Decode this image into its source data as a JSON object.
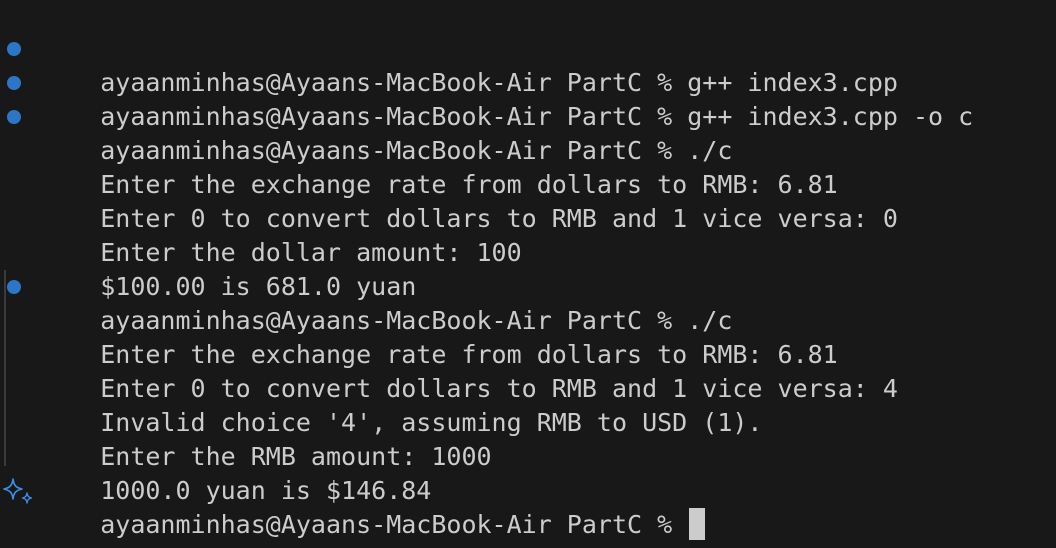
{
  "terminal": {
    "colors": {
      "background": "#181818",
      "text": "#cccccc",
      "command_dot": "#2c76c8",
      "sparkle": "#3b8eea"
    },
    "lines": [
      {
        "marker": "dot",
        "text": "ayaanminhas@Ayaans-MacBook-Air PartC % g++ index3.cpp"
      },
      {
        "marker": "dot",
        "text": "ayaanminhas@Ayaans-MacBook-Air PartC % g++ index3.cpp -o c"
      },
      {
        "marker": "dot",
        "text": "ayaanminhas@Ayaans-MacBook-Air PartC % ./c"
      },
      {
        "marker": "none",
        "text": "Enter the exchange rate from dollars to RMB: 6.81"
      },
      {
        "marker": "none",
        "text": "Enter 0 to convert dollars to RMB and 1 vice versa: 0"
      },
      {
        "marker": "none",
        "text": "Enter the dollar amount: 100"
      },
      {
        "marker": "none",
        "text": "$100.00 is 681.0 yuan"
      },
      {
        "marker": "dot",
        "text": "ayaanminhas@Ayaans-MacBook-Air PartC % ./c"
      },
      {
        "marker": "none",
        "text": "Enter the exchange rate from dollars to RMB: 6.81"
      },
      {
        "marker": "none",
        "text": "Enter 0 to convert dollars to RMB and 1 vice versa: 4"
      },
      {
        "marker": "none",
        "text": "Invalid choice '4', assuming RMB to USD (1)."
      },
      {
        "marker": "none",
        "text": "Enter the RMB amount: 1000"
      },
      {
        "marker": "none",
        "text": "1000.0 yuan is $146.84"
      }
    ],
    "prompt": {
      "marker": "sparkle-icon",
      "text": "ayaanminhas@Ayaans-MacBook-Air PartC % "
    }
  }
}
